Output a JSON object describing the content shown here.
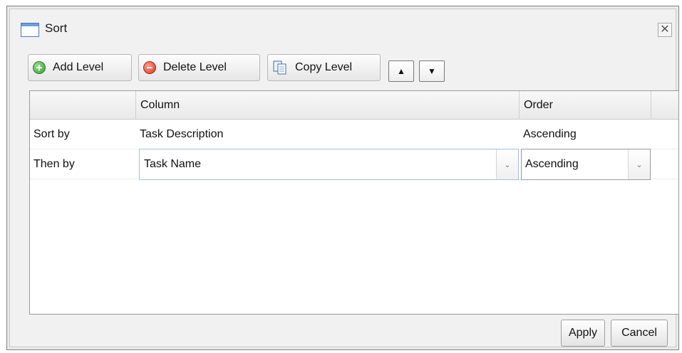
{
  "dialog": {
    "title": "Sort",
    "close_glyph": "✕",
    "icon": "window-icon"
  },
  "toolbar": {
    "add_level": "Add Level",
    "delete_level": "Delete Level",
    "copy_level": "Copy Level",
    "move_up_glyph": "▲",
    "move_down_glyph": "▼"
  },
  "grid": {
    "headers": [
      "",
      "Column",
      "Order"
    ],
    "rows": [
      {
        "label": "Sort by",
        "column": "Task Description",
        "order": "Ascending",
        "editing": false
      },
      {
        "label": "Then by",
        "column": "Task Name",
        "order": "Ascending",
        "editing": true
      }
    ],
    "dropdown_glyph": "⌄"
  },
  "footer": {
    "apply": "Apply",
    "cancel": "Cancel"
  }
}
